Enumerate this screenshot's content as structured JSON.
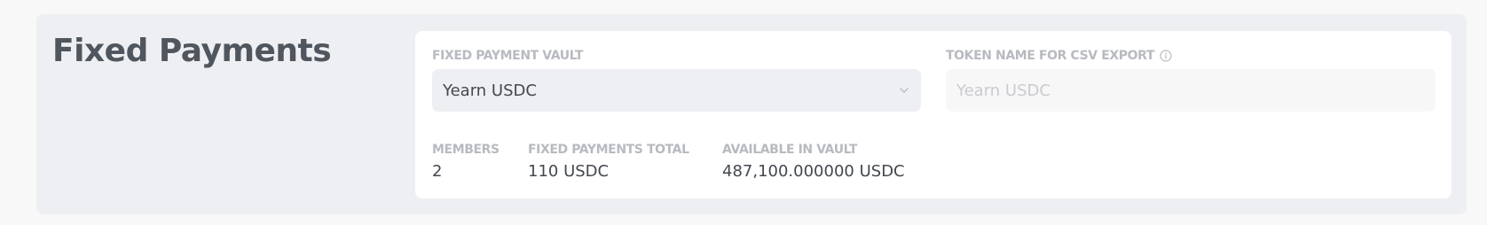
{
  "section": {
    "title": "Fixed Payments"
  },
  "vault": {
    "label": "FIXED PAYMENT VAULT",
    "selected": "Yearn USDC"
  },
  "token_name": {
    "label": "TOKEN NAME FOR CSV EXPORT",
    "placeholder": "Yearn USDC",
    "value": ""
  },
  "stats": {
    "members_label": "MEMBERS",
    "members_value": "2",
    "total_label": "FIXED PAYMENTS TOTAL",
    "total_value": "110 USDC",
    "available_label": "AVAILABLE IN VAULT",
    "available_value": "487,100.000000 USDC"
  },
  "icons": {
    "info": "info-circle-icon",
    "chevron": "chevron-down-icon"
  },
  "colors": {
    "section_bg": "#eeeff2",
    "card_bg": "#ffffff",
    "label": "#b7bac0",
    "title": "#50565e",
    "text": "#43484f"
  }
}
